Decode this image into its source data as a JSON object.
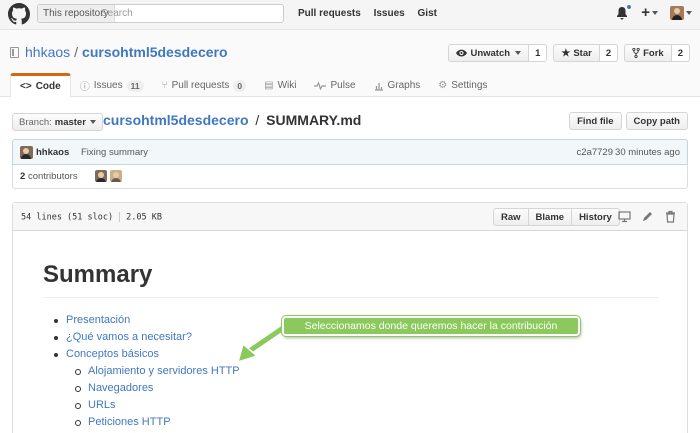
{
  "header": {
    "search_scope": "This repository",
    "search_placeholder": "Search",
    "nav": [
      "Pull requests",
      "Issues",
      "Gist"
    ],
    "plus_label": "+"
  },
  "repo": {
    "owner": "hhkaos",
    "separator": "/",
    "name": "cursohtml5desdecero",
    "actions": {
      "watch_label": "Unwatch",
      "watch_count": "1",
      "star_label": "Star",
      "star_count": "2",
      "fork_label": "Fork",
      "fork_count": "2"
    }
  },
  "tabs": [
    {
      "label": "Code",
      "icon": "code-icon"
    },
    {
      "label": "Issues",
      "count": "11",
      "icon": "issue-icon"
    },
    {
      "label": "Pull requests",
      "count": "0",
      "icon": "pull-request-icon"
    },
    {
      "label": "Wiki",
      "icon": "book-icon"
    },
    {
      "label": "Pulse",
      "icon": "pulse-icon"
    },
    {
      "label": "Graphs",
      "icon": "graph-icon"
    },
    {
      "label": "Settings",
      "icon": "gear-icon"
    }
  ],
  "file_nav": {
    "branch_prefix": "Branch:",
    "branch": "master",
    "breadcrumb_repo": "cursohtml5desdecero",
    "breadcrumb_sep": "/",
    "file_name": "SUMMARY.md",
    "find_file": "Find file",
    "copy_path": "Copy path"
  },
  "commit": {
    "author": "hhkaos",
    "message": "Fixing summary",
    "sha": "c2a7729",
    "time": "30 minutes ago",
    "contributors_count": "2",
    "contributors_label": "contributors"
  },
  "file": {
    "lines": "54 lines (51 sloc)",
    "size": "2.05 KB",
    "buttons": [
      "Raw",
      "Blame",
      "History"
    ]
  },
  "markdown": {
    "heading": "Summary",
    "items": [
      {
        "label": "Presentación"
      },
      {
        "label": "¿Qué vamos a necesitar?"
      },
      {
        "label": "Conceptos básicos",
        "children": [
          "Alojamiento y servidores HTTP",
          "Navegadores",
          "URLs",
          "Peticiones HTTP"
        ]
      }
    ]
  },
  "annotation": {
    "text": "Seleccionamos donde queremos hacer la contribución",
    "color": "#8bc95c"
  },
  "colors": {
    "link": "#4078c0",
    "tab_accent": "#d26911",
    "notification_dot": "#4078c0"
  }
}
